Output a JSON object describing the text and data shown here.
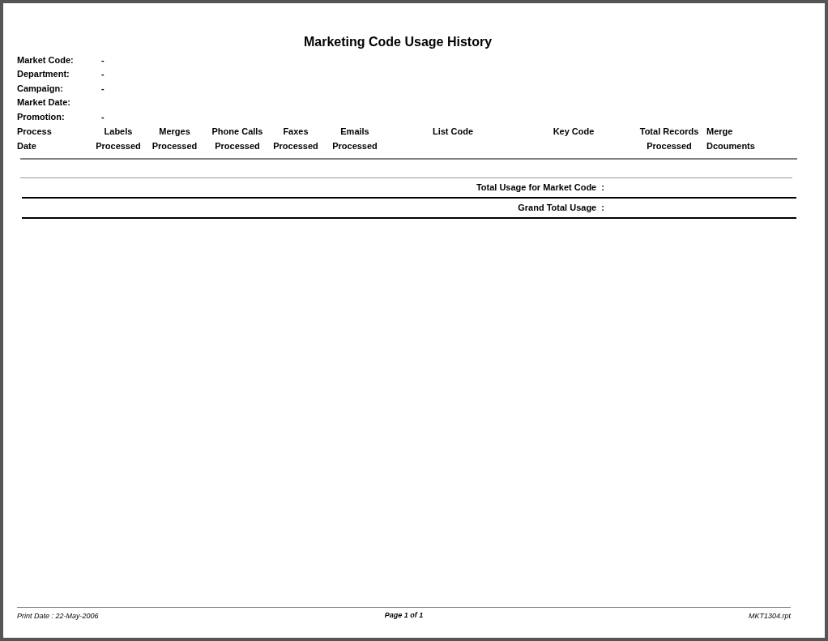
{
  "report": {
    "title": "Marketing Code Usage History",
    "fields": [
      {
        "label": "Market Code:",
        "value": "-"
      },
      {
        "label": "Department:",
        "value": "-"
      },
      {
        "label": "Campaign:",
        "value": "-"
      },
      {
        "label": "Market Date:"
      },
      {
        "label": "Promotion:",
        "value": "-"
      }
    ],
    "columns": [
      {
        "lines": [
          "Process",
          "Date"
        ]
      },
      {
        "lines": [
          "Labels",
          "Processed"
        ]
      },
      {
        "lines": [
          "Merges",
          "Processed"
        ]
      },
      {
        "lines": [
          "Phone Calls",
          "Processed"
        ]
      },
      {
        "lines": [
          "Faxes",
          "Processed"
        ]
      },
      {
        "lines": [
          "Emails",
          "Processed"
        ]
      },
      {
        "lines": [
          "List Code"
        ]
      },
      {
        "lines": [
          "Key Code"
        ]
      },
      {
        "lines": [
          "Total Records",
          "Processed"
        ]
      },
      {
        "lines": [
          "Merge",
          "Dcouments"
        ]
      }
    ],
    "totals": [
      {
        "label": "Total Usage for Market Code  :"
      },
      {
        "label": "Grand Total Usage  :"
      }
    ],
    "footer": {
      "print_date": "Print Date : 22-May-2006",
      "page": "Page 1 of 1",
      "file": "MKT1304.rpt"
    }
  }
}
